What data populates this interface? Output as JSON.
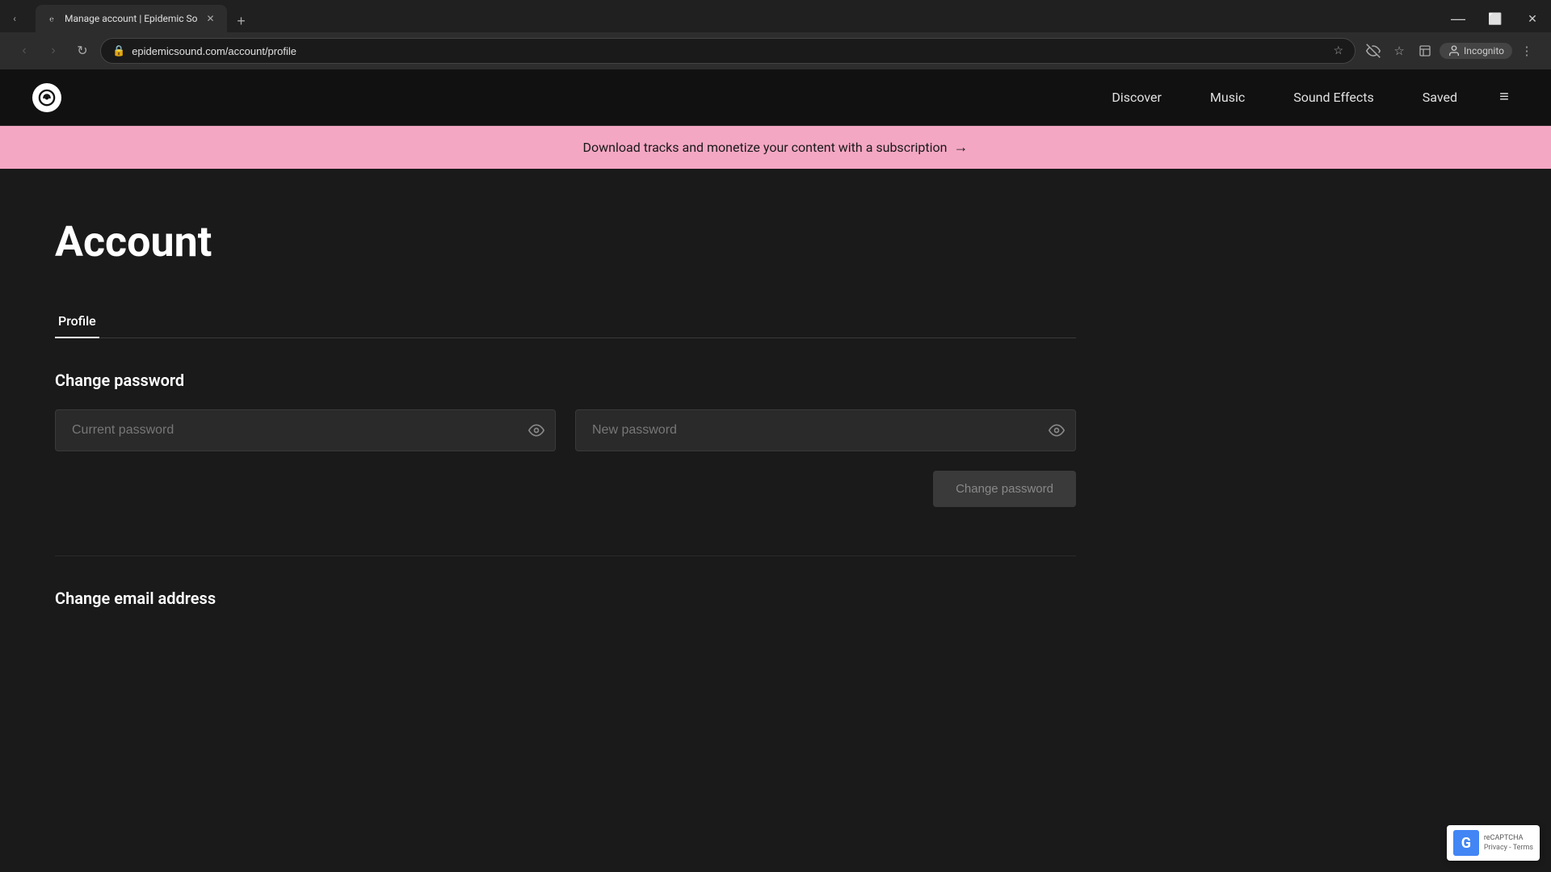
{
  "browser": {
    "tab": {
      "title": "Manage account | Epidemic So",
      "url": "epidemicsound.com/account/profile"
    },
    "nav": {
      "back_label": "←",
      "forward_label": "→",
      "refresh_label": "↻",
      "new_tab_label": "+"
    },
    "toolbar": {
      "incognito_label": "Incognito"
    }
  },
  "nav": {
    "logo_symbol": "℮",
    "links": [
      {
        "label": "Discover"
      },
      {
        "label": "Music"
      },
      {
        "label": "Sound Effects"
      },
      {
        "label": "Saved"
      }
    ],
    "hamburger_label": "≡"
  },
  "banner": {
    "text": "Download tracks and monetize your content with a subscription",
    "arrow": "→"
  },
  "page": {
    "title": "Account",
    "tabs": [
      {
        "label": "Profile"
      }
    ],
    "change_password": {
      "section_title": "Change password",
      "current_password_placeholder": "Current password",
      "new_password_placeholder": "New password",
      "button_label": "Change password"
    },
    "change_email": {
      "section_title": "Change email address"
    }
  },
  "recaptcha": {
    "logo": "G",
    "line1": "reCAPTCHA",
    "line2": "Privacy - Terms"
  },
  "colors": {
    "bg": "#1a1a1a",
    "nav_bg": "#111111",
    "banner_bg": "#f4a7c3",
    "input_bg": "#2a2a2a",
    "accent": "#ffffff"
  }
}
